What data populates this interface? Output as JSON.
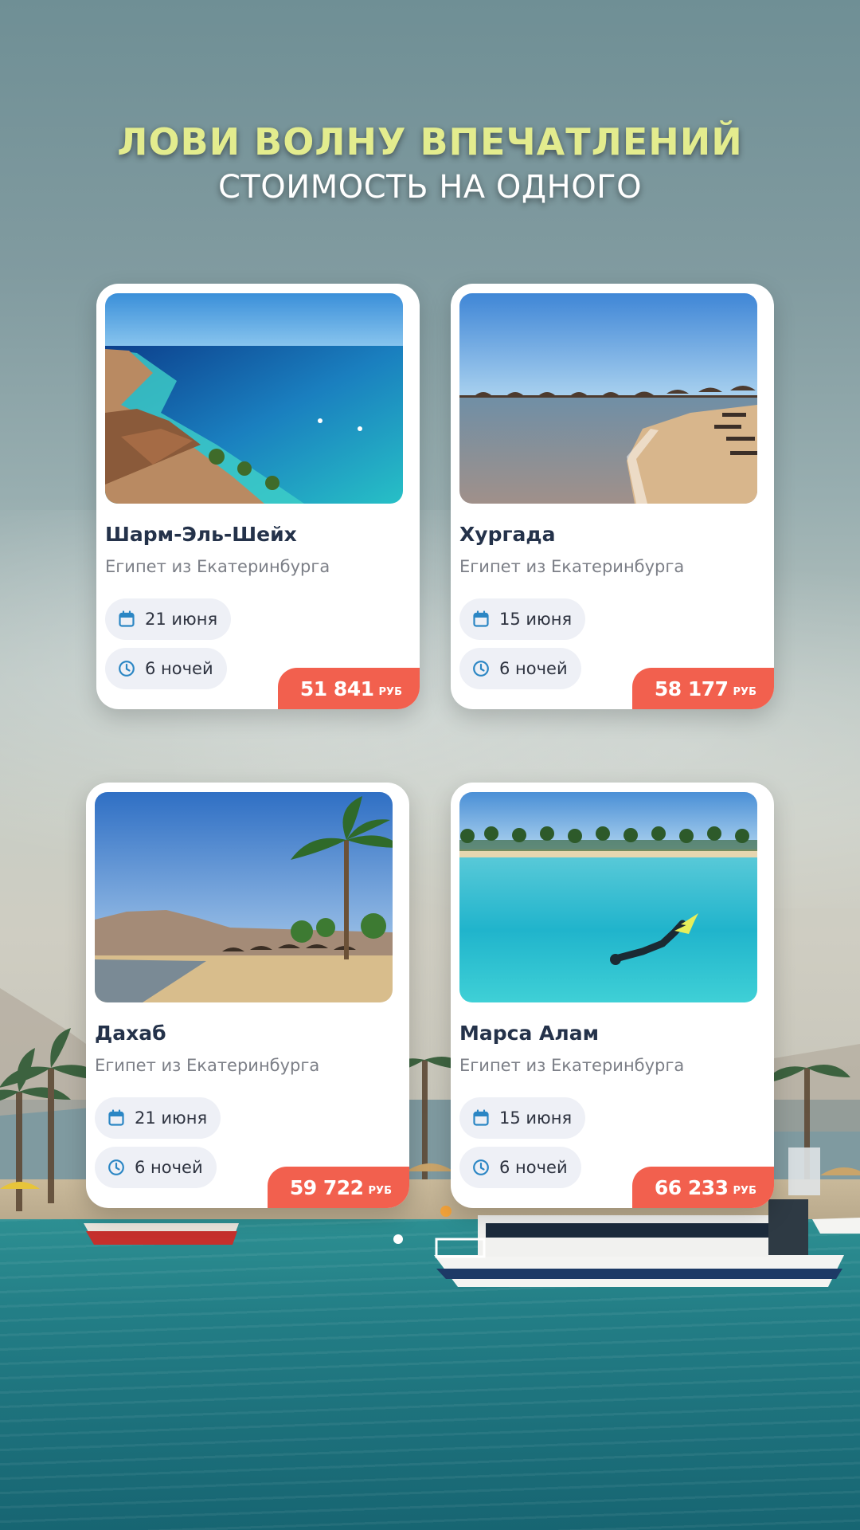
{
  "header": {
    "title": "ЛОВИ ВОЛНУ ВПЕЧАТЛЕНИЙ",
    "subtitle": "СТОИМОСТЬ НА ОДНОГО"
  },
  "colors": {
    "title": "#e3ec8e",
    "price_badge": "#f2604e",
    "icon": "#2b86c4",
    "destination_text": "#24324a"
  },
  "icons": {
    "date": "calendar-icon",
    "nights": "clock-icon"
  },
  "tours": [
    {
      "destination": "Шарм-Эль-Шейх",
      "origin": "Египет из Екатеринбурга",
      "date": "21 июня",
      "nights": "6 ночей",
      "price": "51 841",
      "currency": "РУБ"
    },
    {
      "destination": "Хургада",
      "origin": "Египет из Екатеринбурга",
      "date": "15 июня",
      "nights": "6 ночей",
      "price": "58 177",
      "currency": "РУБ"
    },
    {
      "destination": "Дахаб",
      "origin": "Египет из Екатеринбурга",
      "date": "21 июня",
      "nights": "6 ночей",
      "price": "59 722",
      "currency": "РУБ"
    },
    {
      "destination": "Марса Алам",
      "origin": "Египет из Екатеринбурга",
      "date": "15 июня",
      "nights": "6 ночей",
      "price": "66 233",
      "currency": "РУБ"
    }
  ]
}
